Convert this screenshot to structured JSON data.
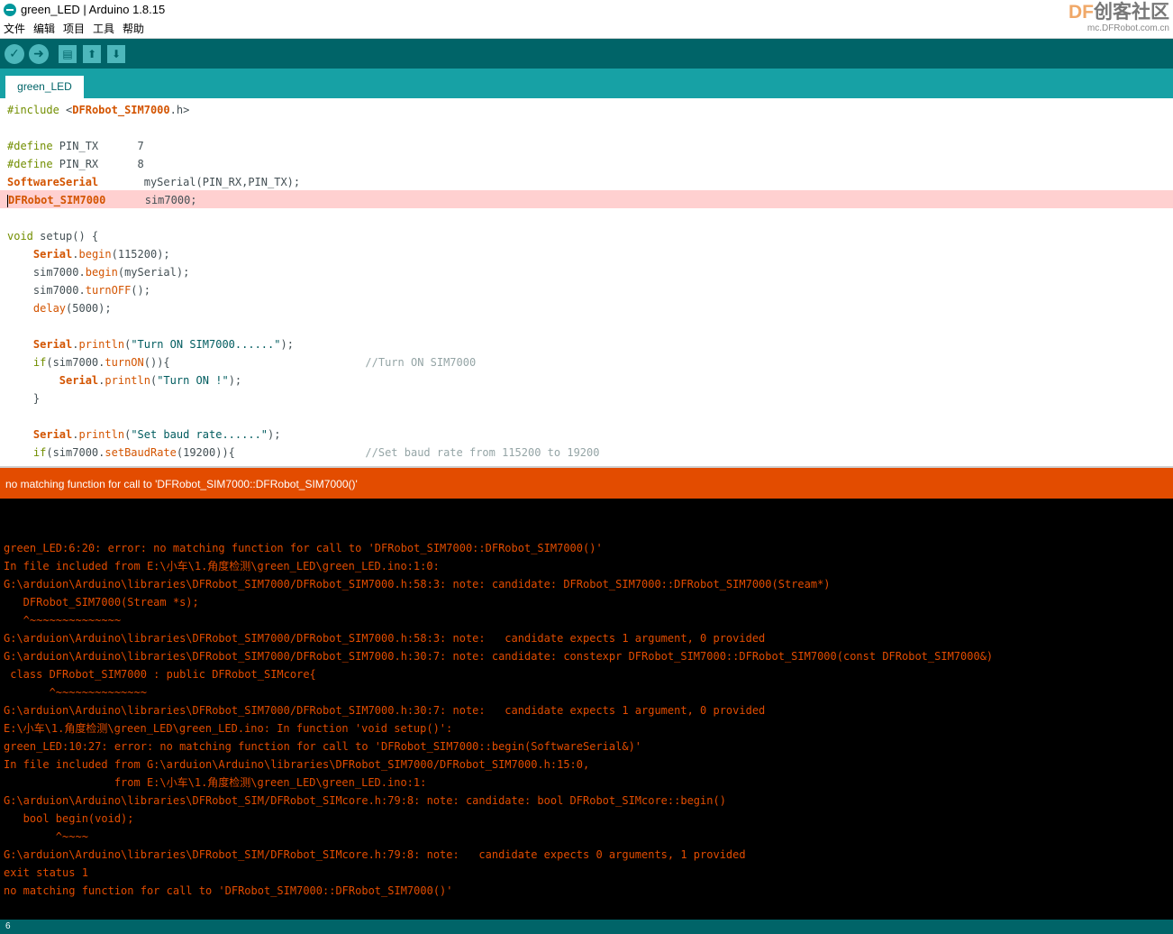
{
  "window": {
    "title": "green_LED | Arduino 1.8.15"
  },
  "menu": [
    "文件",
    "编辑",
    "项目",
    "工具",
    "帮助"
  ],
  "logo": {
    "brand_prefix": "DF",
    "brand_cn": "创客社区",
    "url": "mc.DFRobot.com.cn"
  },
  "toolbar": {
    "verify_glyph": "✓",
    "upload_glyph": "➜",
    "new_glyph": "▤",
    "open_glyph": "⬆",
    "save_glyph": "⬇"
  },
  "tabs": [
    {
      "label": "green_LED"
    }
  ],
  "code": {
    "include_kw": "#include ",
    "include_open": "<",
    "include_lib": "DFRobot_SIM7000",
    "include_close": ".h>",
    "define_kw": "#define ",
    "pin_tx": "PIN_TX      7",
    "pin_rx": "PIN_RX      8",
    "sw_type": "SoftwareSerial",
    "sw_rest": "       mySerial(PIN_RX,PIN_TX);",
    "dfr_type": "DFRobot_SIM7000",
    "dfr_rest": "      sim7000;",
    "void_kw": "void ",
    "setup_fn": "setup",
    "setup_rest": "() {",
    "indent1": "    ",
    "indent2": "        ",
    "serial": "Serial",
    "dot": ".",
    "begin": "begin",
    "println": "println",
    "baud": "(115200);",
    "sim_obj": "sim7000",
    "begin_arg": "(mySerial);",
    "turnoff": "turnOFF",
    "empty_call": "();",
    "delay_fn": "delay",
    "delay_arg": "(5000);",
    "open_paren": "(",
    "str_turn_on": "\"Turn ON SIM7000......\"",
    "close_paren": ");",
    "if_kw": "if",
    "if_open": "(sim7000.",
    "turnon": "turnON",
    "if_close_turnon": "()){                              ",
    "cmt_turnon": "//Turn ON SIM7000",
    "str_turn_on_ok": "\"Turn ON !\"",
    "brace_close": "    }",
    "str_baud": "\"Set baud rate......\"",
    "setbaud": "setBaudRate",
    "if_close_baud": "(19200)){                    ",
    "cmt_baud": "//Set baud rate from 115200 to 19200"
  },
  "error_bar": "no matching function for call to 'DFRobot_SIM7000::DFRobot_SIM7000()'",
  "console": [
    "green_LED:6:20: error: no matching function for call to 'DFRobot_SIM7000::DFRobot_SIM7000()'",
    "In file included from E:\\小车\\1.角度检测\\green_LED\\green_LED.ino:1:0:",
    "G:\\arduion\\Arduino\\libraries\\DFRobot_SIM7000/DFRobot_SIM7000.h:58:3: note: candidate: DFRobot_SIM7000::DFRobot_SIM7000(Stream*)",
    "   DFRobot_SIM7000(Stream *s);",
    "   ^~~~~~~~~~~~~~~",
    "G:\\arduion\\Arduino\\libraries\\DFRobot_SIM7000/DFRobot_SIM7000.h:58:3: note:   candidate expects 1 argument, 0 provided",
    "G:\\arduion\\Arduino\\libraries\\DFRobot_SIM7000/DFRobot_SIM7000.h:30:7: note: candidate: constexpr DFRobot_SIM7000::DFRobot_SIM7000(const DFRobot_SIM7000&)",
    " class DFRobot_SIM7000 : public DFRobot_SIMcore{",
    "       ^~~~~~~~~~~~~~~",
    "G:\\arduion\\Arduino\\libraries\\DFRobot_SIM7000/DFRobot_SIM7000.h:30:7: note:   candidate expects 1 argument, 0 provided",
    "E:\\小车\\1.角度检测\\green_LED\\green_LED.ino: In function 'void setup()':",
    "green_LED:10:27: error: no matching function for call to 'DFRobot_SIM7000::begin(SoftwareSerial&)'",
    "In file included from G:\\arduion\\Arduino\\libraries\\DFRobot_SIM7000/DFRobot_SIM7000.h:15:0,",
    "                 from E:\\小车\\1.角度检测\\green_LED\\green_LED.ino:1:",
    "G:\\arduion\\Arduino\\libraries\\DFRobot_SIM/DFRobot_SIMcore.h:79:8: note: candidate: bool DFRobot_SIMcore::begin()",
    "   bool begin(void);",
    "        ^~~~~",
    "G:\\arduion\\Arduino\\libraries\\DFRobot_SIM/DFRobot_SIMcore.h:79:8: note:   candidate expects 0 arguments, 1 provided",
    "exit status 1",
    "no matching function for call to 'DFRobot_SIM7000::DFRobot_SIM7000()'"
  ],
  "status": {
    "line_number": "6"
  },
  "colors": {
    "toolbar_bg": "#006468",
    "tab_bg": "#17a1a5",
    "error_bg": "#e34c00",
    "console_text": "#e34c00",
    "line_highlight": "#ffd0d0"
  }
}
